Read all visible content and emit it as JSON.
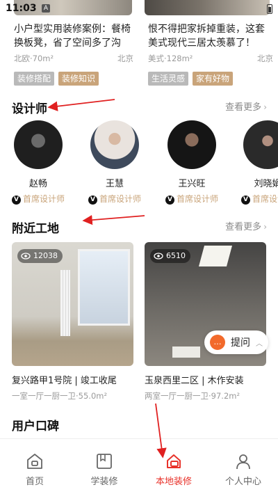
{
  "status_bar": {
    "time": "11:03",
    "a_icon": "A"
  },
  "articles": [
    {
      "title": "小户型实用装修案例：餐椅换板凳，省了空间多了沟",
      "meta_left": "北欧·70m²",
      "city": "北京",
      "tags": [
        "装修搭配",
        "装修知识"
      ]
    },
    {
      "title": "恨不得把家拆掉重装，这套美式现代三居太羡慕了！",
      "meta_left": "美式·128m²",
      "city": "北京",
      "tags": [
        "生活灵感",
        "家有好物"
      ]
    }
  ],
  "designers_section": {
    "title": "设计师",
    "see_more": "查看更多"
  },
  "designers": [
    {
      "name": "赵畅",
      "role": "首席设计师"
    },
    {
      "name": "王慧",
      "role": "首席设计师"
    },
    {
      "name": "王兴旺",
      "role": "首席设计师"
    },
    {
      "name": "刘晓娟",
      "role": "首席设计师"
    }
  ],
  "sites_section": {
    "title": "附近工地",
    "see_more": "查看更多"
  },
  "sites": [
    {
      "views": "12038",
      "title": "复兴路甲1号院 | 竣工收尾",
      "sub": "一室一厅一厨一卫·55.0m²"
    },
    {
      "views": "6510",
      "title": "玉泉西里二区 | 木作安装",
      "sub": "两室一厅一厨一卫·97.2m²"
    }
  ],
  "reviews_section": {
    "title": "用户口碑"
  },
  "ask_button": {
    "label": "提问"
  },
  "bottom_nav": [
    {
      "label": "首页",
      "icon": "home-icon",
      "active": false
    },
    {
      "label": "学装修",
      "icon": "book-icon",
      "active": false
    },
    {
      "label": "本地装修",
      "icon": "local-decor-icon",
      "active": true
    },
    {
      "label": "个人中心",
      "icon": "person-icon",
      "active": false
    }
  ],
  "colors": {
    "accent": "#e8322a",
    "brown": "#c9a47a",
    "orange": "#f26a2b",
    "gray_tag": "#b9b9b9"
  }
}
